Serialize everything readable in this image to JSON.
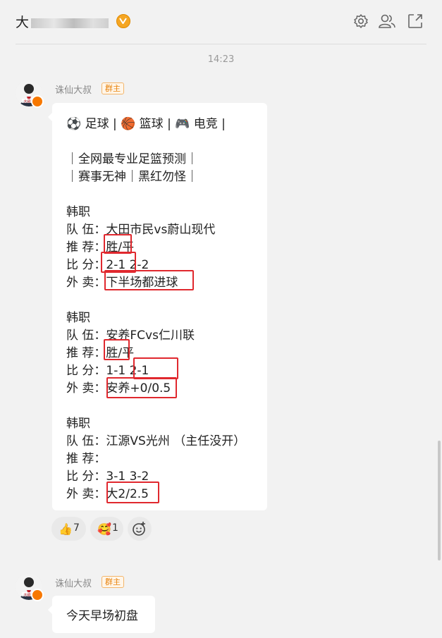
{
  "header": {
    "title_visible": "大",
    "icons": [
      "settings-icon",
      "group-members-icon",
      "share-icon"
    ]
  },
  "timeline": "14:23",
  "messages": [
    {
      "sender": "诛仙大叔",
      "role": "群主",
      "lines": [
        "⚽ 足球 | 🏀 篮球 | 🎮 电竞 |",
        "",
        "｜全网最专业足篮预测｜",
        "｜赛事无神｜黑红勿怪｜",
        "",
        "韩职",
        "队  伍：大田市民vs蔚山现代",
        "推  荐：胜/平",
        "比  分：2-1   2-2",
        "外  卖：下半场都进球",
        "",
        "韩职",
        "队  伍：安养FCvs仁川联",
        "推  荐：胜/平",
        "比  分：1-1   2-1",
        "外  卖：安养+0/0.5",
        "",
        "韩职",
        "队  伍：江源VS光州 （主任没开）",
        "推  荐：",
        "比  分：3-1   3-2",
        "外  卖：大2/2.5"
      ],
      "reactions": [
        {
          "emoji": "👍",
          "count": "7"
        },
        {
          "emoji": "🥰",
          "count": "1"
        }
      ],
      "add_reaction_icon": "add-emoji-icon"
    },
    {
      "sender": "诛仙大叔",
      "role": "群主",
      "lines": [
        "今天早场初盘"
      ]
    }
  ],
  "colors": {
    "background": "#f2f2f2",
    "bubble": "#ffffff",
    "highlight_box": "#e0282e",
    "role_badge": "#e8820c"
  }
}
